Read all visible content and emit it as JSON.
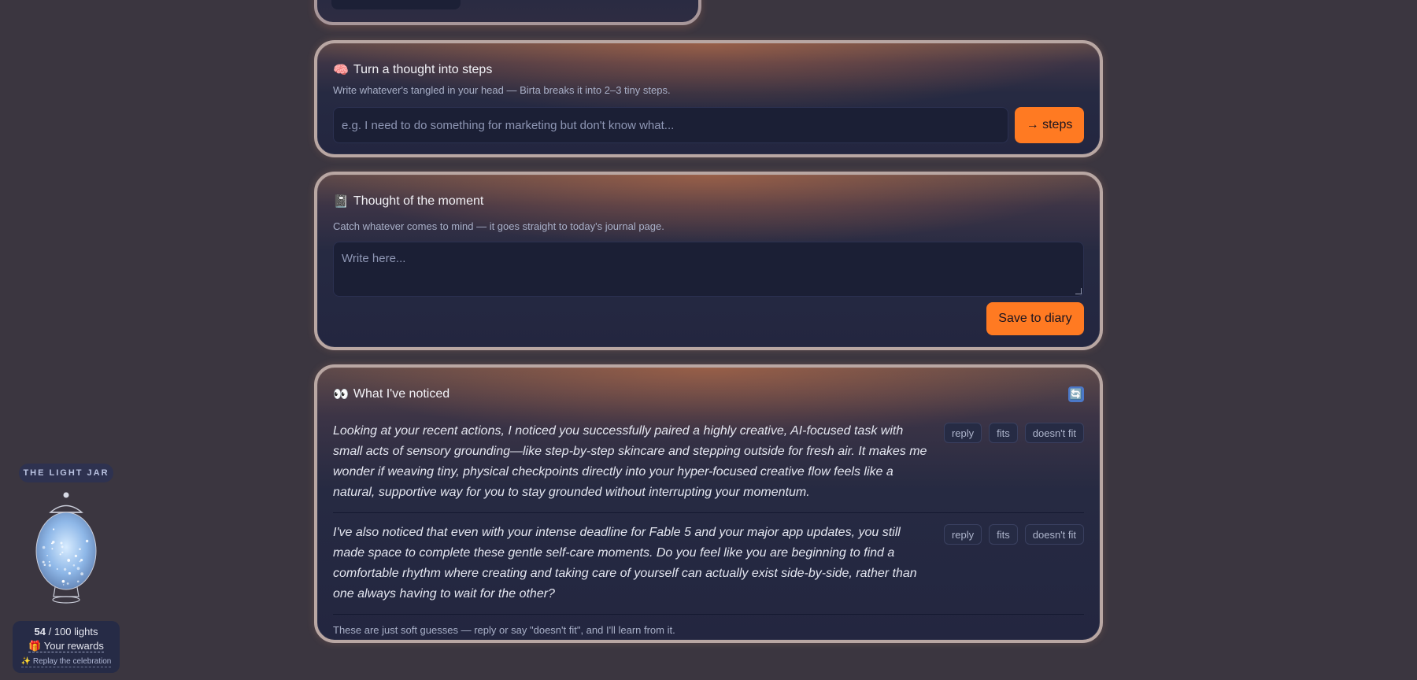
{
  "steps_card": {
    "icon": "brain-icon",
    "emoji": "🧠",
    "title": "Turn a thought into steps",
    "subtitle": "Write whatever's tangled in your head — Birta breaks it into 2–3 tiny steps.",
    "input_placeholder": "e.g. I need to do something for marketing but don't know what...",
    "button_label": "→ steps"
  },
  "thought_card": {
    "icon": "notebook-icon",
    "emoji": "📓",
    "title": "Thought of the moment",
    "subtitle": "Catch whatever comes to mind — it goes straight to today's journal page.",
    "textarea_placeholder": "Write here...",
    "save_label": "Save to diary"
  },
  "noticed_card": {
    "icon": "eyes-icon",
    "emoji": "👀",
    "title": "What I've noticed",
    "refresh_icon": "refresh-icon",
    "refresh_glyph": "🔄",
    "notices": [
      {
        "text": "Looking at your recent actions, I noticed you successfully paired a highly creative, AI-focused task with small acts of sensory grounding—like step-by-step skincare and stepping outside for fresh air. It makes me wonder if weaving tiny, physical checkpoints directly into your hyper-focused creative flow feels like a natural, supportive way for you to stay grounded without interrupting your momentum.",
        "reply": "reply",
        "fits": "fits",
        "doesnt_fit": "doesn't fit"
      },
      {
        "text": "I've also noticed that even with your intense deadline for Fable 5 and your major app updates, you still made space to complete these gentle self-care moments. Do you feel like you are beginning to find a comfortable rhythm where creating and taking care of yourself can actually exist side-by-side, rather than one always having to wait for the other?",
        "reply": "reply",
        "fits": "fits",
        "doesnt_fit": "doesn't fit"
      }
    ],
    "footnote": "These are just soft guesses — reply or say \"doesn't fit\", and I'll learn from it."
  },
  "light_jar": {
    "label": "THE LIGHT JAR",
    "count": "54",
    "total_text": "/ 100 lights",
    "rewards_emoji": "🎁",
    "rewards_label": "Your rewards",
    "replay_emoji": "✨",
    "replay_label": "Replay the celebration",
    "fill_fraction": 0.54,
    "colors": {
      "glass": "#8fb8e8",
      "glow": "#d8ecff"
    }
  },
  "colors": {
    "accent": "#ff7a22",
    "background": "#3b3640",
    "card": "#232640"
  }
}
